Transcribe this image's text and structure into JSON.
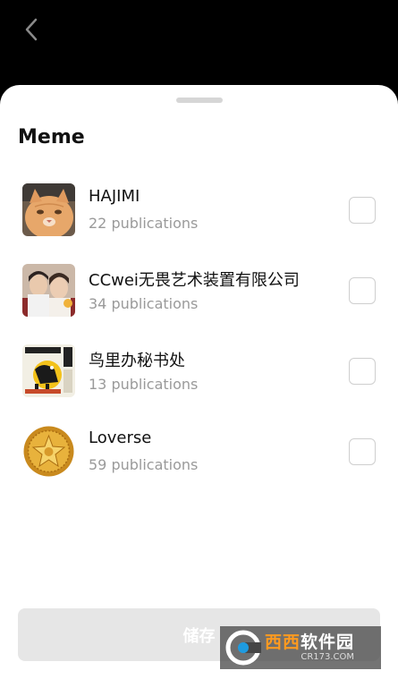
{
  "sheet": {
    "title": "Meme",
    "save_label": "储存"
  },
  "items": [
    {
      "name": "HAJIMI",
      "sub": "22 publications",
      "avatar": "orange-cat-avatar",
      "checked": false
    },
    {
      "name": "CCwei无畏艺术装置有限公司",
      "sub": "34 publications",
      "avatar": "two-people-photo-avatar",
      "checked": false
    },
    {
      "name": "鸟里办秘书处",
      "sub": "13 publications",
      "avatar": "flockwork-poster-avatar",
      "checked": false
    },
    {
      "name": "Loverse",
      "sub": "59 publications",
      "avatar": "gold-coin-avatar",
      "checked": false
    }
  ],
  "watermark": {
    "title_a": "西西",
    "title_b": "软件园",
    "url": "CR173.COM"
  },
  "colors": {
    "accent_disabled": "#e6e6e6",
    "background_top": "#000000",
    "watermark_orange": "#ff9a1f"
  }
}
